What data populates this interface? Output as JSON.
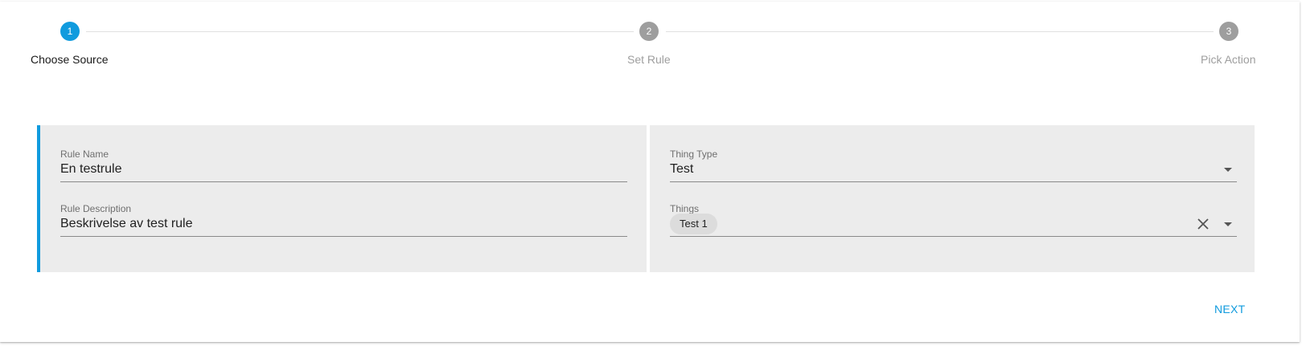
{
  "stepper": {
    "steps": [
      {
        "number": "1",
        "label": "Choose Source",
        "state": "active"
      },
      {
        "number": "2",
        "label": "Set Rule",
        "state": "inactive"
      },
      {
        "number": "3",
        "label": "Pick Action",
        "state": "inactive"
      }
    ]
  },
  "left_panel": {
    "rule_name": {
      "label": "Rule Name",
      "value": "En testrule"
    },
    "rule_description": {
      "label": "Rule Description",
      "value": "Beskrivelse av test rule"
    }
  },
  "right_panel": {
    "thing_type": {
      "label": "Thing Type",
      "value": "Test"
    },
    "things": {
      "label": "Things",
      "chips": [
        "Test 1"
      ]
    }
  },
  "actions": {
    "next_label": "NEXT"
  },
  "colors": {
    "accent": "#109bde",
    "inactive_step": "#9e9e9e",
    "panel_bg": "#ececec"
  }
}
